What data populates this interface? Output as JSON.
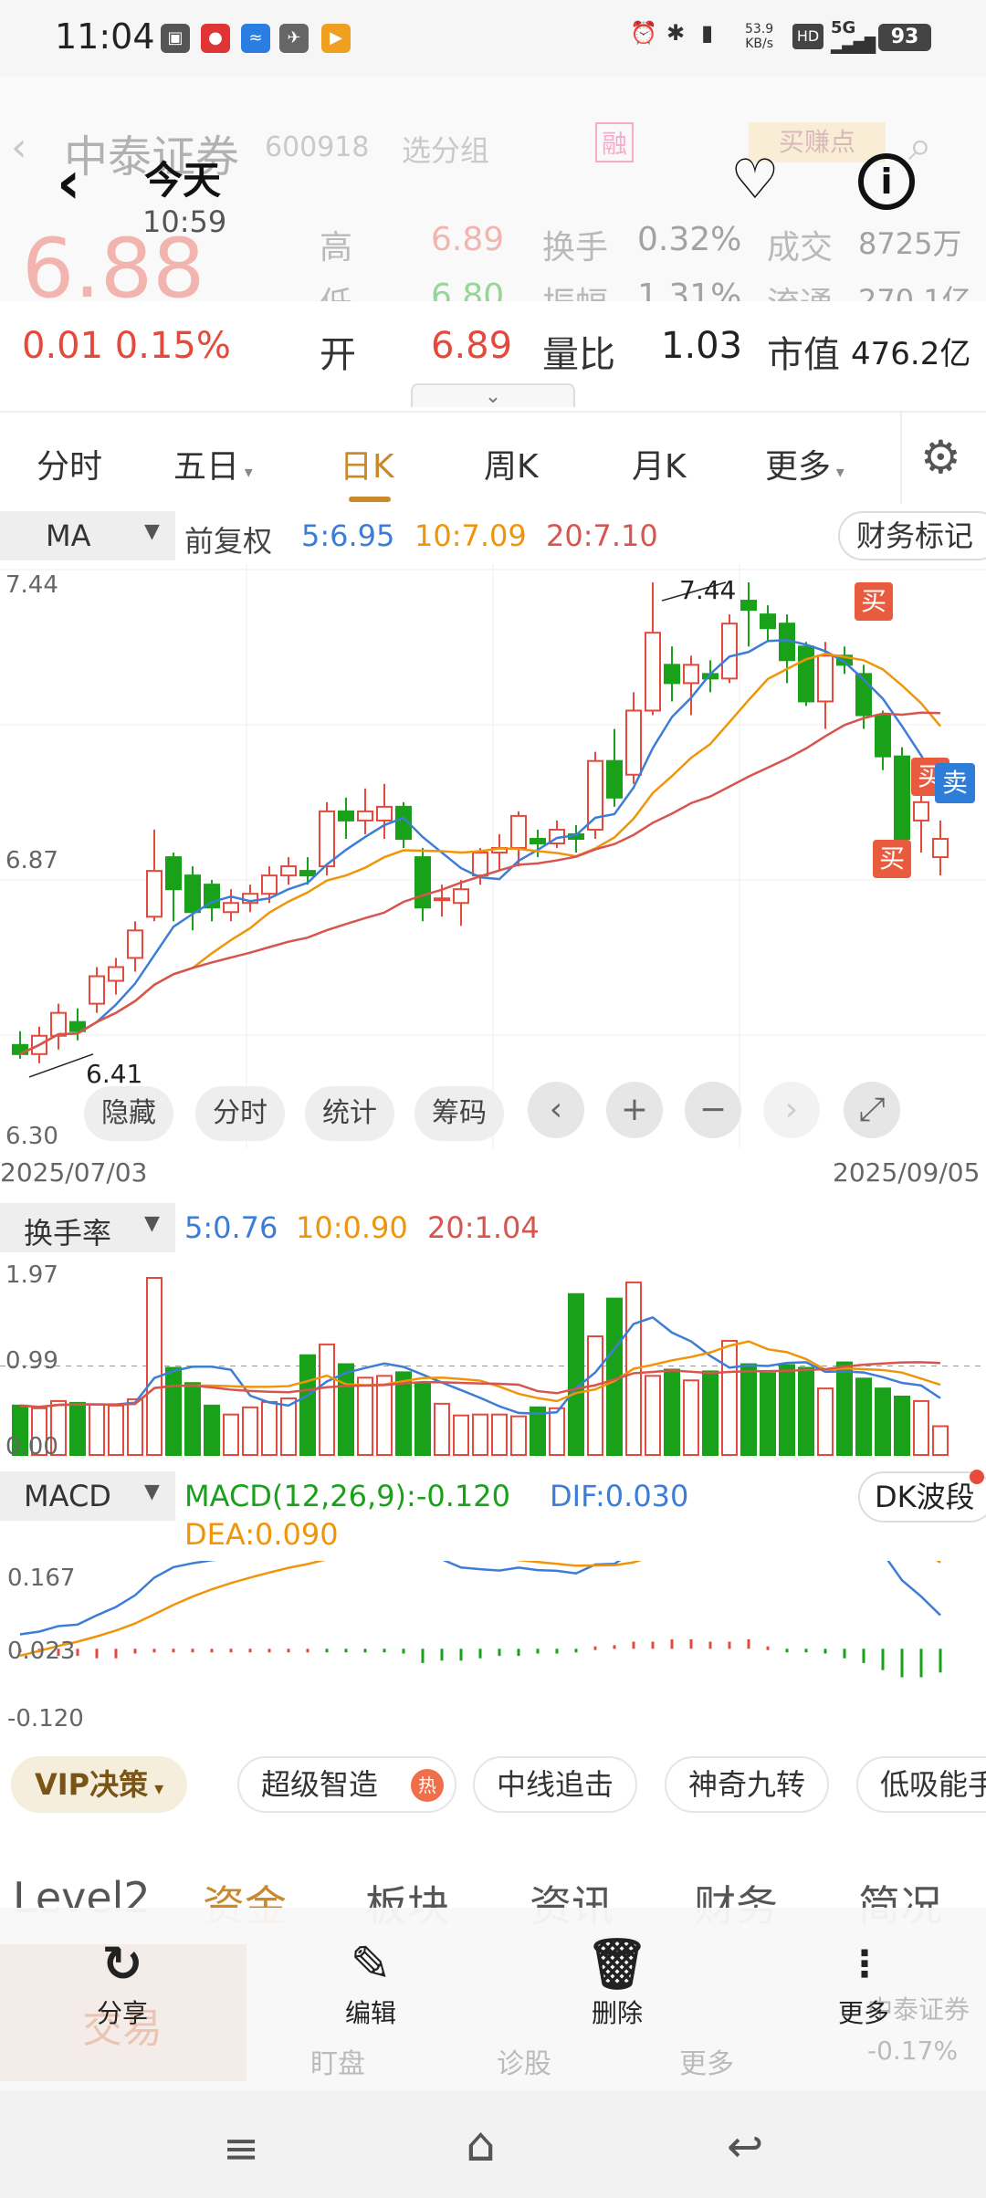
{
  "status": {
    "time": "11:04",
    "speed": "53.9",
    "speed_unit": "KB/s",
    "net": "5G",
    "battery": "93"
  },
  "bg_header": {
    "stock_name": "中泰证券",
    "code": "600918",
    "watch": "选分组",
    "badge": "融",
    "fav": "买赚点",
    "price": "6.88",
    "high_label": "高",
    "high": "6.89",
    "turnover_label": "换手",
    "turnover": "0.32%",
    "volume_label": "成交",
    "volume": "8725万",
    "low_label": "低",
    "low": "6.80",
    "amp_label": "振幅",
    "amp": "1.31%",
    "float_label": "流通",
    "float": "270.1亿"
  },
  "title": {
    "main": "今天",
    "sub": "10:59"
  },
  "quote": {
    "change": "0.01 0.15%",
    "open_label": "开",
    "open": "6.89",
    "ratio_label": "量比",
    "ratio": "1.03",
    "mcap_label": "市值",
    "mcap": "476.2亿"
  },
  "tabs": [
    "分时",
    "五日",
    "日K",
    "周K",
    "月K",
    "更多"
  ],
  "ind": {
    "ma": "MA",
    "adj": "前复权",
    "ma5": "5:6.95",
    "ma10": "10:7.09",
    "ma20": "20:7.10",
    "fin": "财务标记"
  },
  "kchart": {
    "ymax": "7.44",
    "ymid": "6.87",
    "ymin": "6.30",
    "date_start": "2025/07/03",
    "date_end": "2025/09/05",
    "high_mark": "7.44",
    "low_mark": "6.41",
    "buy": "买",
    "sell": "卖"
  },
  "kctrls": {
    "hide": "隐藏",
    "fenshi": "分时",
    "stats": "统计",
    "chips": "筹码"
  },
  "vol": {
    "label": "换手率",
    "ma5": "5:0.76",
    "ma10": "10:0.90",
    "ma20": "20:1.04",
    "ymax": "1.97",
    "ymid": "0.99",
    "ymin": "0.00"
  },
  "macd": {
    "label": "MACD",
    "params": "MACD(12,26,9):-0.120",
    "dif": "DIF:0.030",
    "dea": "DEA:0.090",
    "dk": "DK波段",
    "y1": "0.167",
    "y2": "0.023",
    "y3": "-0.120"
  },
  "vip": {
    "label": "VIP决策",
    "pills": [
      "超级智造",
      "中线追击",
      "神奇九转",
      "低吸能手"
    ],
    "hot": "热"
  },
  "bottom_tabs": [
    "Level2",
    "资金",
    "板块",
    "资讯",
    "财务",
    "简况"
  ],
  "bg_bottom": {
    "b1": "交易",
    "b2": "盯盘",
    "b3": "诊股",
    "b4": "更多",
    "b5": "中泰证券",
    "b6": "-0.17%"
  },
  "actions": [
    "分享",
    "编辑",
    "删除",
    "更多"
  ],
  "colors": {
    "up": "#e4493c",
    "down": "#1aa11a",
    "ma5": "#3d7dd6",
    "ma10": "#f0950a",
    "ma20": "#d8544f",
    "accent": "#c98a2c"
  },
  "chart_data": {
    "type": "candlestick",
    "title": "",
    "x_start": "2025/07/03",
    "x_end": "2025/09/05",
    "ylim": [
      6.3,
      7.44
    ],
    "candles": [
      {
        "o": 6.43,
        "c": 6.41,
        "h": 6.46,
        "l": 6.4
      },
      {
        "o": 6.41,
        "c": 6.45,
        "h": 6.47,
        "l": 6.39
      },
      {
        "o": 6.45,
        "c": 6.5,
        "h": 6.52,
        "l": 6.42
      },
      {
        "o": 6.48,
        "c": 6.46,
        "h": 6.51,
        "l": 6.44
      },
      {
        "o": 6.52,
        "c": 6.58,
        "h": 6.6,
        "l": 6.5
      },
      {
        "o": 6.57,
        "c": 6.6,
        "h": 6.62,
        "l": 6.54
      },
      {
        "o": 6.62,
        "c": 6.68,
        "h": 6.7,
        "l": 6.59
      },
      {
        "o": 6.71,
        "c": 6.81,
        "h": 6.9,
        "l": 6.7
      },
      {
        "o": 6.84,
        "c": 6.77,
        "h": 6.85,
        "l": 6.7
      },
      {
        "o": 6.8,
        "c": 6.72,
        "h": 6.82,
        "l": 6.68
      },
      {
        "o": 6.78,
        "c": 6.73,
        "h": 6.79,
        "l": 6.7
      },
      {
        "o": 6.72,
        "c": 6.74,
        "h": 6.77,
        "l": 6.7
      },
      {
        "o": 6.74,
        "c": 6.76,
        "h": 6.78,
        "l": 6.72
      },
      {
        "o": 6.76,
        "c": 6.8,
        "h": 6.82,
        "l": 6.74
      },
      {
        "o": 6.8,
        "c": 6.82,
        "h": 6.84,
        "l": 6.78
      },
      {
        "o": 6.81,
        "c": 6.8,
        "h": 6.84,
        "l": 6.78
      },
      {
        "o": 6.82,
        "c": 6.94,
        "h": 6.96,
        "l": 6.8
      },
      {
        "o": 6.94,
        "c": 6.92,
        "h": 6.97,
        "l": 6.88
      },
      {
        "o": 6.92,
        "c": 6.94,
        "h": 6.99,
        "l": 6.89
      },
      {
        "o": 6.92,
        "c": 6.95,
        "h": 7.0,
        "l": 6.88
      },
      {
        "o": 6.95,
        "c": 6.88,
        "h": 6.96,
        "l": 6.86
      },
      {
        "o": 6.84,
        "c": 6.73,
        "h": 6.86,
        "l": 6.7
      },
      {
        "o": 6.75,
        "c": 6.75,
        "h": 6.78,
        "l": 6.71
      },
      {
        "o": 6.74,
        "c": 6.77,
        "h": 6.79,
        "l": 6.69
      },
      {
        "o": 6.8,
        "c": 6.85,
        "h": 6.86,
        "l": 6.78
      },
      {
        "o": 6.85,
        "c": 6.86,
        "h": 6.89,
        "l": 6.81
      },
      {
        "o": 6.86,
        "c": 6.93,
        "h": 6.94,
        "l": 6.82
      },
      {
        "o": 6.88,
        "c": 6.87,
        "h": 6.9,
        "l": 6.84
      },
      {
        "o": 6.87,
        "c": 6.9,
        "h": 6.92,
        "l": 6.86
      },
      {
        "o": 6.89,
        "c": 6.88,
        "h": 6.91,
        "l": 6.85
      },
      {
        "o": 6.9,
        "c": 7.05,
        "h": 7.07,
        "l": 6.88
      },
      {
        "o": 7.05,
        "c": 6.97,
        "h": 7.12,
        "l": 6.95
      },
      {
        "o": 7.02,
        "c": 7.16,
        "h": 7.2,
        "l": 7.0
      },
      {
        "o": 7.16,
        "c": 7.33,
        "h": 7.44,
        "l": 7.15
      },
      {
        "o": 7.26,
        "c": 7.22,
        "h": 7.3,
        "l": 7.18
      },
      {
        "o": 7.22,
        "c": 7.26,
        "h": 7.28,
        "l": 7.15
      },
      {
        "o": 7.24,
        "c": 7.23,
        "h": 7.27,
        "l": 7.2
      },
      {
        "o": 7.23,
        "c": 7.35,
        "h": 7.37,
        "l": 7.22
      },
      {
        "o": 7.4,
        "c": 7.38,
        "h": 7.44,
        "l": 7.3
      },
      {
        "o": 7.37,
        "c": 7.34,
        "h": 7.39,
        "l": 7.31
      },
      {
        "o": 7.35,
        "c": 7.27,
        "h": 7.37,
        "l": 7.22
      },
      {
        "o": 7.3,
        "c": 7.18,
        "h": 7.31,
        "l": 7.17
      },
      {
        "o": 7.18,
        "c": 7.28,
        "h": 7.31,
        "l": 7.12
      },
      {
        "o": 7.28,
        "c": 7.26,
        "h": 7.3,
        "l": 7.24
      },
      {
        "o": 7.24,
        "c": 7.15,
        "h": 7.26,
        "l": 7.12
      },
      {
        "o": 7.15,
        "c": 7.06,
        "h": 7.16,
        "l": 7.03
      },
      {
        "o": 7.06,
        "c": 6.88,
        "h": 7.08,
        "l": 6.86
      },
      {
        "o": 6.92,
        "c": 6.96,
        "h": 6.98,
        "l": 6.85
      },
      {
        "o": 6.84,
        "c": 6.88,
        "h": 6.92,
        "l": 6.8
      }
    ],
    "turnover": [
      0.55,
      0.52,
      0.6,
      0.58,
      0.56,
      0.55,
      0.62,
      1.97,
      0.97,
      0.8,
      0.55,
      0.45,
      0.53,
      0.59,
      0.63,
      1.11,
      1.23,
      1.01,
      0.86,
      0.88,
      0.92,
      0.8,
      0.57,
      0.44,
      0.45,
      0.45,
      0.43,
      0.53,
      0.52,
      1.79,
      1.32,
      1.74,
      1.92,
      0.88,
      0.95,
      0.83,
      0.93,
      1.27,
      1.01,
      0.91,
      1.0,
      0.97,
      0.74,
      1.03,
      0.85,
      0.74,
      0.65,
      0.6,
      0.32
    ],
    "macd_hist": [
      -0.01,
      -0.014,
      -0.03,
      -0.03,
      -0.04,
      -0.04,
      -0.02,
      -0.015,
      -0.012,
      -0.014,
      -0.015,
      -0.01,
      -0.01,
      -0.01,
      -0.01,
      -0.01,
      -0.012,
      0.0,
      0.0,
      0.0,
      -0.02,
      -0.06,
      -0.05,
      -0.05,
      -0.04,
      -0.03,
      -0.03,
      -0.02,
      -0.02,
      -0.01,
      0.01,
      0.015,
      0.03,
      0.03,
      0.04,
      0.04,
      0.03,
      0.03,
      0.04,
      0.01,
      -0.01,
      -0.01,
      -0.02,
      -0.04,
      -0.06,
      -0.09,
      -0.12,
      -0.12,
      -0.1
    ],
    "macd_ylim": [
      -0.12,
      0.167
    ]
  }
}
